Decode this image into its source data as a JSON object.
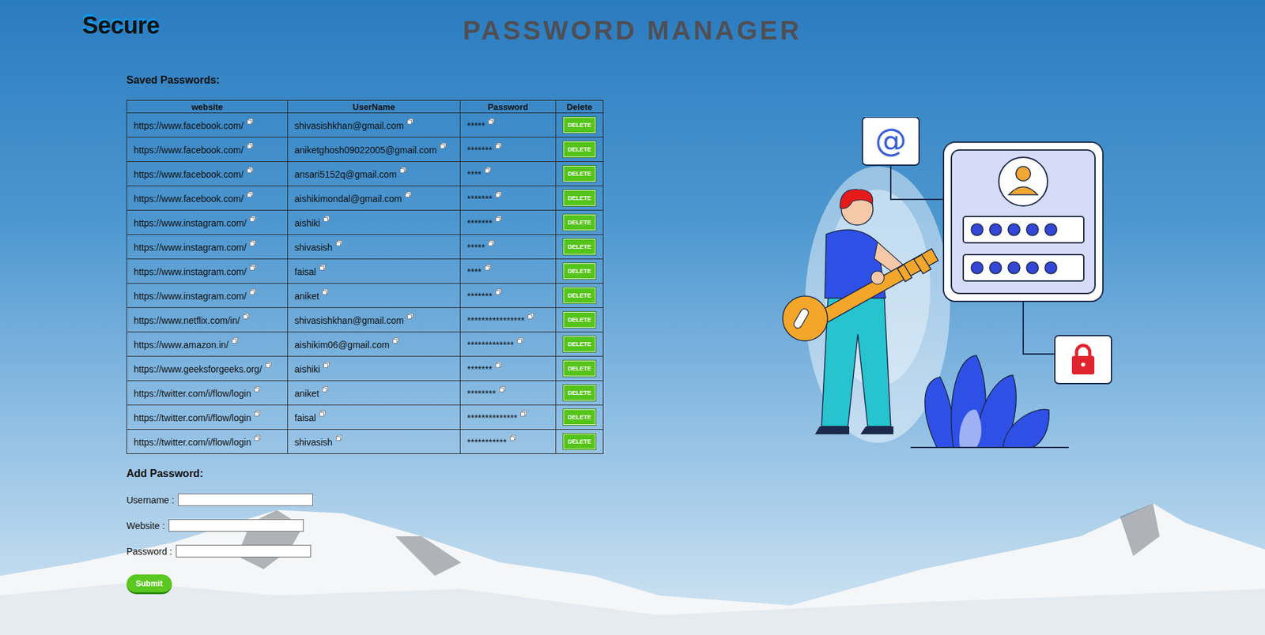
{
  "logo": "Secure",
  "title": "PASSWORD MANAGER",
  "saved": {
    "heading": "Saved Passwords:",
    "columns": [
      "website",
      "UserName",
      "Password",
      "Delete"
    ],
    "rows": [
      {
        "website": "https://www.facebook.com/",
        "username": "shivasishkhan@gmail.com",
        "password": "*****",
        "delete": "DELETE"
      },
      {
        "website": "https://www.facebook.com/",
        "username": "aniketghosh09022005@gmail.com",
        "password": "*******",
        "delete": "DELETE"
      },
      {
        "website": "https://www.facebook.com/",
        "username": "ansari5152q@gmail.com",
        "password": "****",
        "delete": "DELETE"
      },
      {
        "website": "https://www.facebook.com/",
        "username": "aishikimondal@gmail.com",
        "password": "*******",
        "delete": "DELETE"
      },
      {
        "website": "https://www.instagram.com/",
        "username": "aishiki",
        "password": "*******",
        "delete": "DELETE"
      },
      {
        "website": "https://www.instagram.com/",
        "username": "shivasish",
        "password": "*****",
        "delete": "DELETE"
      },
      {
        "website": "https://www.instagram.com/",
        "username": "faisal",
        "password": "****",
        "delete": "DELETE"
      },
      {
        "website": "https://www.instagram.com/",
        "username": "aniket",
        "password": "*******",
        "delete": "DELETE"
      },
      {
        "website": "https://www.netflix.com/in/",
        "username": "shivasishkhan@gmail.com",
        "password": "****************",
        "delete": "DELETE"
      },
      {
        "website": "https://www.amazon.in/",
        "username": "aishikim06@gmail.com",
        "password": "*************",
        "delete": "DELETE"
      },
      {
        "website": "https://www.geeksforgeeks.org/",
        "username": "aishiki",
        "password": "*******",
        "delete": "DELETE"
      },
      {
        "website": "https://twitter.com/i/flow/login",
        "username": "aniket",
        "password": "********",
        "delete": "DELETE"
      },
      {
        "website": "https://twitter.com/i/flow/login",
        "username": "faisal",
        "password": "**************",
        "delete": "DELETE"
      },
      {
        "website": "https://twitter.com/i/flow/login",
        "username": "shivasish",
        "password": "***********",
        "delete": "DELETE"
      }
    ]
  },
  "add": {
    "heading": "Add Password:",
    "fields": [
      {
        "label": "Username :",
        "value": ""
      },
      {
        "label": "Website :",
        "value": ""
      },
      {
        "label": "Password :",
        "value": ""
      }
    ],
    "submit": "Submit"
  },
  "illustration": {
    "at_sign": "@"
  }
}
